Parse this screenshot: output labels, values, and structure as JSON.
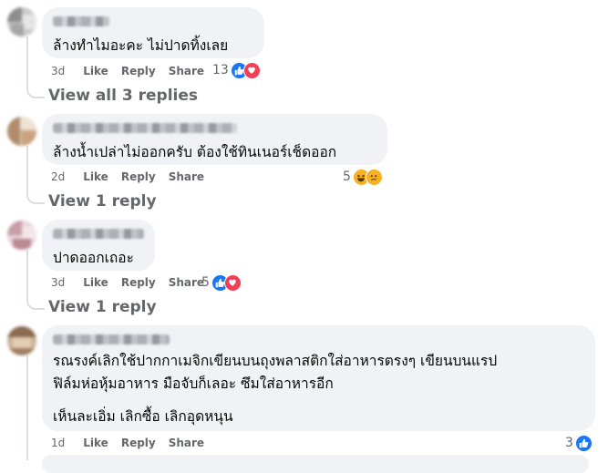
{
  "comments": [
    {
      "text_lines": [
        "ล้างทำไมอะคะ ไม่ปาดทิ้งเลย"
      ],
      "time": "3d",
      "like_label": "Like",
      "reply_label": "Reply",
      "share_label": "Share",
      "reaction_count": "13",
      "reactions": [
        "like-icon",
        "love-icon"
      ],
      "replies_label": "View all 3 replies"
    },
    {
      "text_lines": [
        "ล้างน้ำเปล่าไม่ออกครับ ต้องใช้ทินเนอร์เช็ดออก"
      ],
      "time": "2d",
      "like_label": "Like",
      "reply_label": "Reply",
      "share_label": "Share",
      "reaction_count": "5",
      "reactions": [
        "haha-icon",
        "sad-icon"
      ],
      "replies_label": "View 1 reply"
    },
    {
      "text_lines": [
        "ปาดออกเถอะ"
      ],
      "time": "3d",
      "like_label": "Like",
      "reply_label": "Reply",
      "share_label": "Share",
      "reaction_count": "5",
      "reactions": [
        "like-icon",
        "love-icon"
      ],
      "replies_label": "View 1 reply"
    },
    {
      "text_lines": [
        "รณรงค์เลิกใช้ปากกาเมจิกเขียนบนถุงพลาสติกใส่อาหารตรงๆ เขียนบนแรป",
        "ฟิล์มห่อหุ้มอาหาร มือจับก็เลอะ ซึมใส่อาหารอีก",
        "",
        "เห็นละเอิ่ม เลิกซื้อ เลิกอุดหนุน"
      ],
      "time": "1d",
      "like_label": "Like",
      "reply_label": "Reply",
      "share_label": "Share",
      "reaction_count": "3",
      "reactions": [
        "like-icon"
      ]
    }
  ],
  "colors": {
    "bubble": "#f0f2f5",
    "secondary_text": "#65676b",
    "like_blue": "#1877f2",
    "love_red": "#f33e58",
    "haha_yellow": "#f7b125"
  }
}
